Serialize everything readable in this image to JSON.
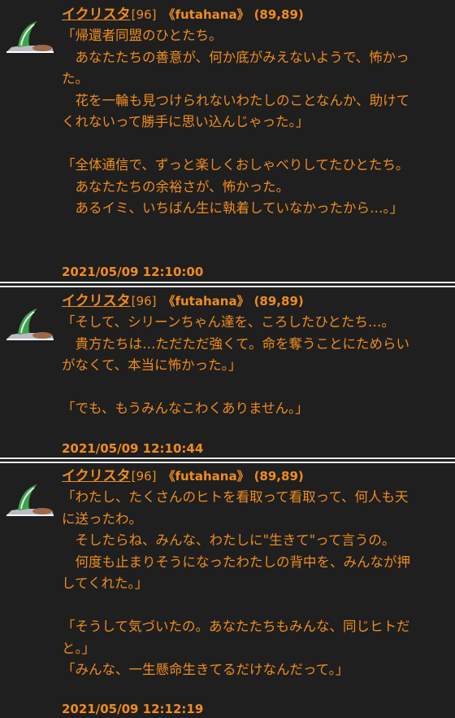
{
  "posts": [
    {
      "name": "イクリスタ",
      "level": "[96]",
      "eno": "《futahana》",
      "coords": "(89,89)",
      "body": "「帰還者同盟のひとたち。\n　あなたたちの善意が、何か底がみえないようで、怖かった。\n　花を一輪も見つけられないわたしのことなんか、助けてくれないって勝手に思い込んじゃった。」\n\n「全体通信で、ずっと楽しくおしゃべりしてたひとたち。\n　あなたたちの余裕さが、怖かった。\n　あるイミ、いちばん生に執着していなかったから…。」",
      "timestamp": "2021/05/09 12:10:00"
    },
    {
      "name": "イクリスタ",
      "level": "[96]",
      "eno": "《futahana》",
      "coords": "(89,89)",
      "body": "「そして、シリーンちゃん達を、ころしたひとたち…。\n　貴方たちは…ただただ強くて。命を奪うことにためらいがなくて、本当に怖かった。」\n\n「でも、もうみんなこわくありません。」",
      "timestamp": "2021/05/09 12:10:44"
    },
    {
      "name": "イクリスタ",
      "level": "[96]",
      "eno": "《futahana》",
      "coords": "(89,89)",
      "body": "「わたし、たくさんのヒトを看取って看取って、何人も天に送ったわ。\n　そしたらね、みんな、わたしに\"生きて\"って言うの。\n　何度も止まりそうになったわたしの背中を、みんなが押してくれた。」\n\n「そうして気づいたの。あなたたちもみんな、同じヒトだと。」\n「みんな、一生懸命生きてるだけなんだって。」",
      "timestamp": "2021/05/09 12:12:19"
    }
  ]
}
